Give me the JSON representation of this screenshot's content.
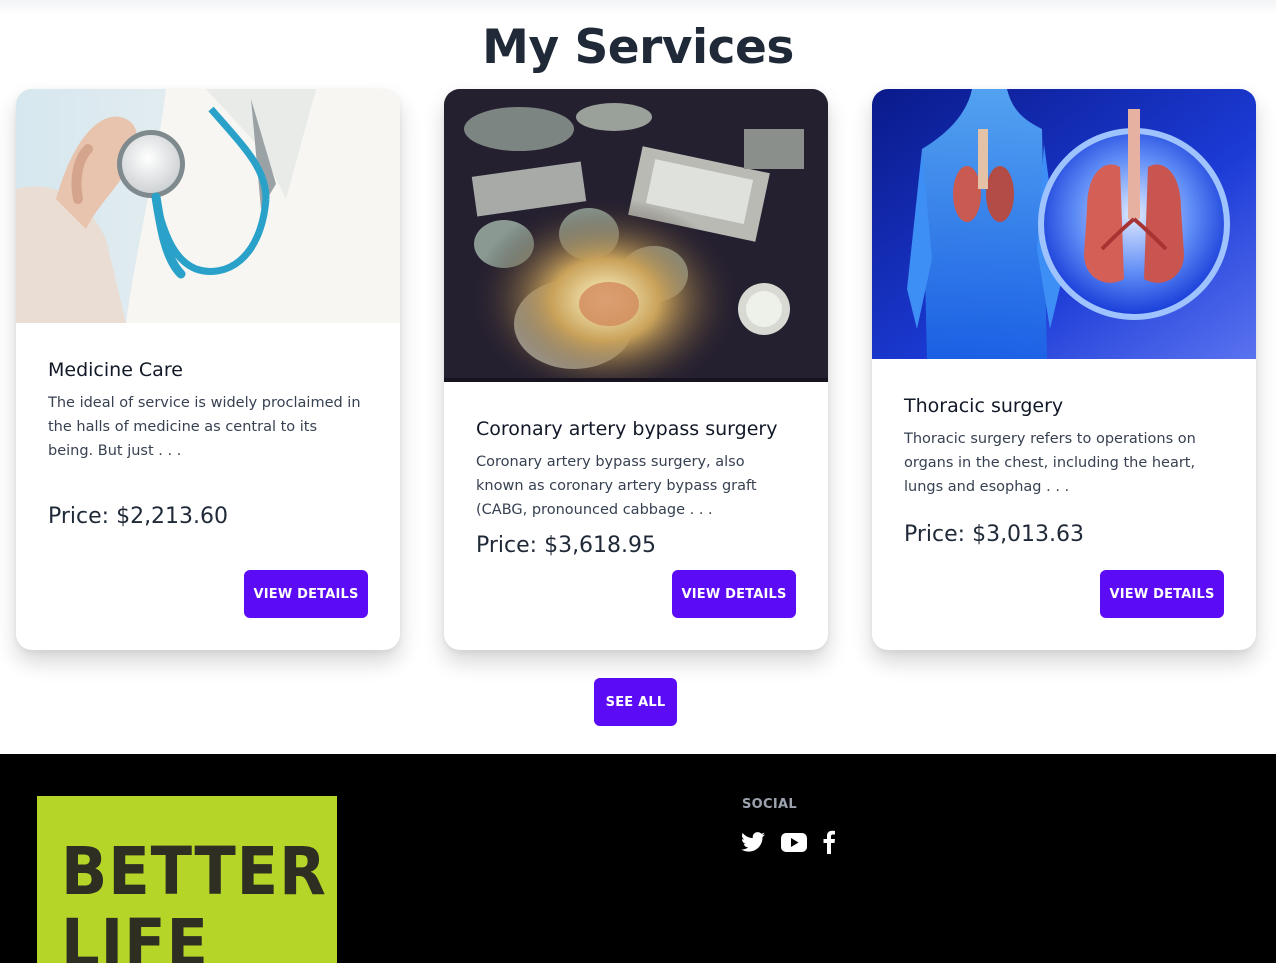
{
  "section": {
    "title": "My Services"
  },
  "services": [
    {
      "title": "Medicine Care",
      "description": "The ideal of service is widely proclaimed in the halls of medicine as central to its being. But just . . .",
      "price": "Price: $2,213.60",
      "button_label": "VIEW DETAILS",
      "image": "doctor-stethoscope-photo"
    },
    {
      "title": "Coronary artery bypass surgery",
      "description": "Coronary artery bypass surgery, also known as coronary artery bypass graft (CABG, pronounced cabbage . . .",
      "price": "Price: $3,618.95",
      "button_label": "VIEW DETAILS",
      "image": "operating-room-photo"
    },
    {
      "title": "Thoracic surgery",
      "description": "Thoracic surgery refers to operations on organs in the chest, including the heart, lungs and esophag . . .",
      "price": "Price: $3,013.63",
      "button_label": "VIEW DETAILS",
      "image": "chest-anatomy-illustration"
    }
  ],
  "see_all_label": "SEE ALL",
  "footer": {
    "logo_text": "BETTER LIFE",
    "social_title": "SOCIAL",
    "social_icons": [
      "twitter-icon",
      "youtube-icon",
      "facebook-icon"
    ]
  },
  "colors": {
    "accent": "#5b0cf5",
    "footer_bg": "#000000",
    "logo_bg": "#b5d628"
  }
}
